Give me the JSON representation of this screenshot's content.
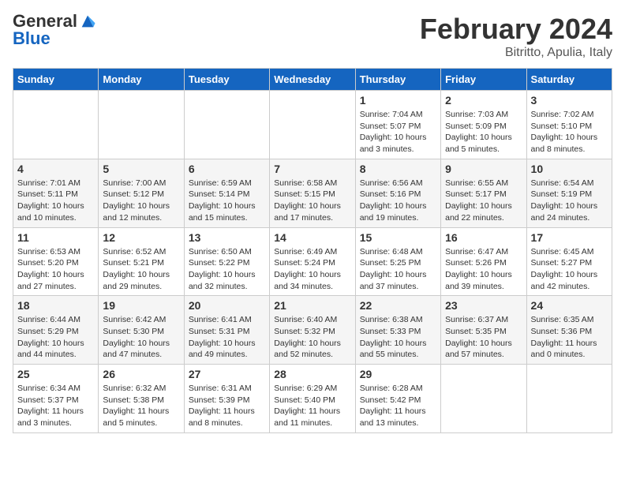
{
  "header": {
    "logo_general": "General",
    "logo_blue": "Blue",
    "title": "February 2024",
    "subtitle": "Bitritto, Apulia, Italy"
  },
  "calendar": {
    "days_of_week": [
      "Sunday",
      "Monday",
      "Tuesday",
      "Wednesday",
      "Thursday",
      "Friday",
      "Saturday"
    ],
    "weeks": [
      [
        {
          "day": "",
          "info": ""
        },
        {
          "day": "",
          "info": ""
        },
        {
          "day": "",
          "info": ""
        },
        {
          "day": "",
          "info": ""
        },
        {
          "day": "1",
          "info": "Sunrise: 7:04 AM\nSunset: 5:07 PM\nDaylight: 10 hours\nand 3 minutes."
        },
        {
          "day": "2",
          "info": "Sunrise: 7:03 AM\nSunset: 5:09 PM\nDaylight: 10 hours\nand 5 minutes."
        },
        {
          "day": "3",
          "info": "Sunrise: 7:02 AM\nSunset: 5:10 PM\nDaylight: 10 hours\nand 8 minutes."
        }
      ],
      [
        {
          "day": "4",
          "info": "Sunrise: 7:01 AM\nSunset: 5:11 PM\nDaylight: 10 hours\nand 10 minutes."
        },
        {
          "day": "5",
          "info": "Sunrise: 7:00 AM\nSunset: 5:12 PM\nDaylight: 10 hours\nand 12 minutes."
        },
        {
          "day": "6",
          "info": "Sunrise: 6:59 AM\nSunset: 5:14 PM\nDaylight: 10 hours\nand 15 minutes."
        },
        {
          "day": "7",
          "info": "Sunrise: 6:58 AM\nSunset: 5:15 PM\nDaylight: 10 hours\nand 17 minutes."
        },
        {
          "day": "8",
          "info": "Sunrise: 6:56 AM\nSunset: 5:16 PM\nDaylight: 10 hours\nand 19 minutes."
        },
        {
          "day": "9",
          "info": "Sunrise: 6:55 AM\nSunset: 5:17 PM\nDaylight: 10 hours\nand 22 minutes."
        },
        {
          "day": "10",
          "info": "Sunrise: 6:54 AM\nSunset: 5:19 PM\nDaylight: 10 hours\nand 24 minutes."
        }
      ],
      [
        {
          "day": "11",
          "info": "Sunrise: 6:53 AM\nSunset: 5:20 PM\nDaylight: 10 hours\nand 27 minutes."
        },
        {
          "day": "12",
          "info": "Sunrise: 6:52 AM\nSunset: 5:21 PM\nDaylight: 10 hours\nand 29 minutes."
        },
        {
          "day": "13",
          "info": "Sunrise: 6:50 AM\nSunset: 5:22 PM\nDaylight: 10 hours\nand 32 minutes."
        },
        {
          "day": "14",
          "info": "Sunrise: 6:49 AM\nSunset: 5:24 PM\nDaylight: 10 hours\nand 34 minutes."
        },
        {
          "day": "15",
          "info": "Sunrise: 6:48 AM\nSunset: 5:25 PM\nDaylight: 10 hours\nand 37 minutes."
        },
        {
          "day": "16",
          "info": "Sunrise: 6:47 AM\nSunset: 5:26 PM\nDaylight: 10 hours\nand 39 minutes."
        },
        {
          "day": "17",
          "info": "Sunrise: 6:45 AM\nSunset: 5:27 PM\nDaylight: 10 hours\nand 42 minutes."
        }
      ],
      [
        {
          "day": "18",
          "info": "Sunrise: 6:44 AM\nSunset: 5:29 PM\nDaylight: 10 hours\nand 44 minutes."
        },
        {
          "day": "19",
          "info": "Sunrise: 6:42 AM\nSunset: 5:30 PM\nDaylight: 10 hours\nand 47 minutes."
        },
        {
          "day": "20",
          "info": "Sunrise: 6:41 AM\nSunset: 5:31 PM\nDaylight: 10 hours\nand 49 minutes."
        },
        {
          "day": "21",
          "info": "Sunrise: 6:40 AM\nSunset: 5:32 PM\nDaylight: 10 hours\nand 52 minutes."
        },
        {
          "day": "22",
          "info": "Sunrise: 6:38 AM\nSunset: 5:33 PM\nDaylight: 10 hours\nand 55 minutes."
        },
        {
          "day": "23",
          "info": "Sunrise: 6:37 AM\nSunset: 5:35 PM\nDaylight: 10 hours\nand 57 minutes."
        },
        {
          "day": "24",
          "info": "Sunrise: 6:35 AM\nSunset: 5:36 PM\nDaylight: 11 hours\nand 0 minutes."
        }
      ],
      [
        {
          "day": "25",
          "info": "Sunrise: 6:34 AM\nSunset: 5:37 PM\nDaylight: 11 hours\nand 3 minutes."
        },
        {
          "day": "26",
          "info": "Sunrise: 6:32 AM\nSunset: 5:38 PM\nDaylight: 11 hours\nand 5 minutes."
        },
        {
          "day": "27",
          "info": "Sunrise: 6:31 AM\nSunset: 5:39 PM\nDaylight: 11 hours\nand 8 minutes."
        },
        {
          "day": "28",
          "info": "Sunrise: 6:29 AM\nSunset: 5:40 PM\nDaylight: 11 hours\nand 11 minutes."
        },
        {
          "day": "29",
          "info": "Sunrise: 6:28 AM\nSunset: 5:42 PM\nDaylight: 11 hours\nand 13 minutes."
        },
        {
          "day": "",
          "info": ""
        },
        {
          "day": "",
          "info": ""
        }
      ]
    ]
  }
}
